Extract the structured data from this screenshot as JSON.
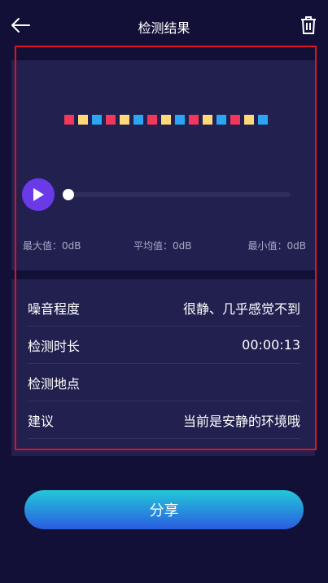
{
  "header": {
    "title": "检测结果",
    "back_icon": "arrow-left-icon",
    "delete_icon": "trash-icon"
  },
  "meter": {
    "bar_colors": [
      "#f2385a",
      "#ffd87a",
      "#2aa6f5",
      "#f2385a",
      "#ffd87a",
      "#2aa6f5",
      "#f2385a",
      "#ffd87a",
      "#2aa6f5",
      "#f2385a",
      "#ffd87a",
      "#2aa6f5",
      "#f2385a",
      "#ffd87a",
      "#2aa6f5"
    ]
  },
  "player": {
    "play_icon": "play-icon",
    "progress": 0,
    "accent": "#6a3ae8"
  },
  "stats": {
    "max": "最大值：0dB",
    "avg": "平均值：0dB",
    "min": "最小值：0dB"
  },
  "details": [
    {
      "label": "噪音程度",
      "value": "很静、几乎感觉不到"
    },
    {
      "label": "检测时长",
      "value": "00:00:13"
    },
    {
      "label": "检测地点",
      "value": ""
    },
    {
      "label": "建议",
      "value": "当前是安静的环境哦"
    }
  ],
  "share_button": "分享"
}
